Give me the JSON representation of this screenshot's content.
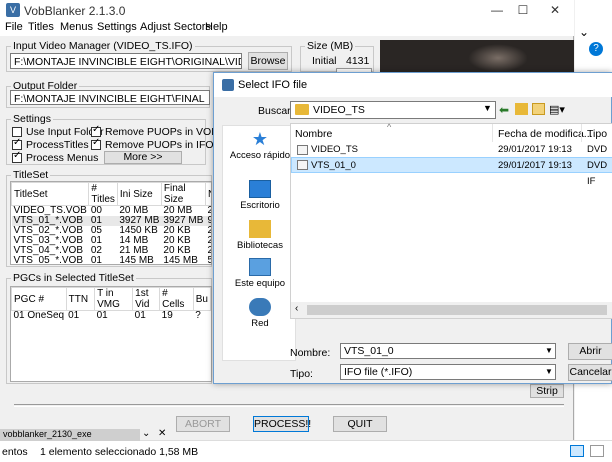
{
  "app": {
    "title": "VobBlanker 2.1.3.0",
    "window_controls": {
      "minimize": "—",
      "maximize": "☐",
      "close": "✕"
    },
    "menu": [
      "File",
      "Titles",
      "Menus",
      "Settings",
      "Adjust Sectors",
      "Help"
    ]
  },
  "input_manager": {
    "label": "Input Video Manager (VIDEO_TS.IFO)",
    "path": "F:\\MONTAJE INVINCIBLE EIGHT\\ORIGINAL\\VIDEO_TS.IFO",
    "browse": "Browse"
  },
  "size": {
    "label": "Size (MB)",
    "initial_label": "Initial",
    "initial_value": "4131"
  },
  "output": {
    "label": "Output Folder",
    "path": "F:\\MONTAJE INVINCIBLE EIGHT\\FINAL"
  },
  "settings": {
    "label": "Settings",
    "checks": [
      {
        "text": "Use Input Folder",
        "checked": false
      },
      {
        "text": "Remove PUOPs in VOBs",
        "checked": true
      },
      {
        "text": "ProcessTitles",
        "checked": true
      },
      {
        "text": "Remove PUOPs in IFOs",
        "checked": true
      },
      {
        "text": "Process Menus",
        "checked": true
      }
    ],
    "more": "More >>"
  },
  "titleset": {
    "label": "TitleSet",
    "columns": [
      "TitleSet",
      "# Titles",
      "Ini Size",
      "Final Size",
      "N"
    ],
    "rows": [
      [
        "VIDEO_TS.VOB",
        "00",
        "20 MB",
        "20 MB",
        "2"
      ],
      [
        "VTS_01_*.VOB",
        "01",
        "3927 MB",
        "3927 MB",
        "9"
      ],
      [
        "VTS_02_*.VOB",
        "05",
        "1450 KB",
        "20 KB",
        "2"
      ],
      [
        "VTS_03_*.VOB",
        "01",
        "14 MB",
        "20 KB",
        "2"
      ],
      [
        "VTS_04_*.VOB",
        "02",
        "21 MB",
        "20 KB",
        "2"
      ],
      [
        "VTS_05_*.VOB",
        "01",
        "145 MB",
        "145 MB",
        "5"
      ]
    ]
  },
  "pgcs": {
    "label": "PGCs in Selected TitleSet",
    "columns": [
      "PGC #",
      "TTN",
      "T in VMG",
      "1st Vid",
      "# Cells",
      "Bu"
    ],
    "rows": [
      [
        "01 OneSeq",
        "01",
        "01",
        "01",
        "19",
        "?"
      ]
    ]
  },
  "strip": "Strip",
  "buttons": {
    "abort": "ABORT",
    "process": "PROCESS!!",
    "quit": "QUIT"
  },
  "dialog": {
    "title": "Select IFO file",
    "lookin_label": "Buscar en:",
    "lookin_value": "VIDEO_TS",
    "columns": {
      "name": "Nombre",
      "date": "Fecha de modifica...",
      "type": "Tipo"
    },
    "files": [
      {
        "name": "VIDEO_TS",
        "date": "29/01/2017 19:13",
        "type": "DVD IF"
      },
      {
        "name": "VTS_01_0",
        "date": "29/01/2017 19:13",
        "type": "DVD IF"
      }
    ],
    "places": [
      "Acceso rápido",
      "Escritorio",
      "Bibliotecas",
      "Este equipo",
      "Red"
    ],
    "filename_label": "Nombre:",
    "filename_value": "VTS_01_0",
    "filetype_label": "Tipo:",
    "filetype_value": "IFO file (*.IFO)",
    "open": "Abrir",
    "cancel": "Cancelar"
  },
  "taskbar": {
    "item": "vobblanker_2130_exe",
    "left_text": "entos",
    "status": "1 elemento seleccionado  1,58 MB"
  },
  "colors": {
    "accent": "#0078d7",
    "selection": "#cce8ff",
    "folder": "#e8b838"
  }
}
